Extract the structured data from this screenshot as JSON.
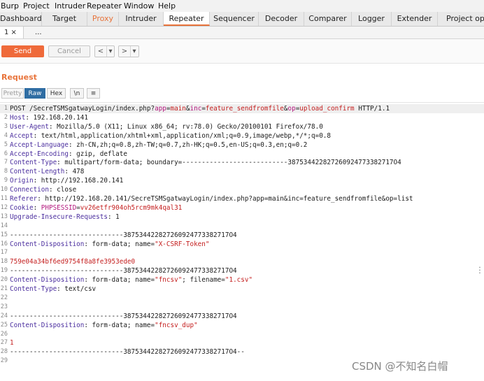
{
  "menu": [
    "Burp",
    "Project",
    "Intruder",
    "Repeater",
    "Window",
    "Help"
  ],
  "tabs": [
    "Dashboard",
    "Target",
    "Proxy",
    "Intruder",
    "Repeater",
    "Sequencer",
    "Decoder",
    "Comparer",
    "Logger",
    "Extender",
    "Project options"
  ],
  "subtabs": [
    "1 ×",
    "..."
  ],
  "toolbar": {
    "send": "Send",
    "cancel": "Cancel",
    "back": "<",
    "back_menu": "▾",
    "forward": ">",
    "forward_menu": "▾"
  },
  "request_title": "Request",
  "view_buttons": [
    "Pretty",
    "Raw",
    "Hex",
    "\\n",
    "≡"
  ],
  "request_lines": [
    [
      {
        "t": "POST /SecreTSMSgatwayLogin/index.php?",
        "c": "bd"
      },
      {
        "t": "app",
        "c": "ak"
      },
      {
        "t": "=",
        "c": "bd"
      },
      {
        "t": "main",
        "c": "cv"
      },
      {
        "t": "&",
        "c": "bd"
      },
      {
        "t": "inc",
        "c": "ak"
      },
      {
        "t": "=",
        "c": "bd"
      },
      {
        "t": "feature_sendfromfile",
        "c": "cv"
      },
      {
        "t": "&",
        "c": "bd"
      },
      {
        "t": "op",
        "c": "ak"
      },
      {
        "t": "=",
        "c": "bd"
      },
      {
        "t": "upload_confirm",
        "c": "cv"
      },
      {
        "t": " HTTP/1.1",
        "c": "bd"
      }
    ],
    [
      {
        "t": "Host",
        "c": "hk"
      },
      {
        "t": ": 192.168.20.141",
        "c": "bd"
      }
    ],
    [
      {
        "t": "User-Agent",
        "c": "hk"
      },
      {
        "t": ": Mozilla/5.0 (X11; Linux x86_64; rv:78.0) Gecko/20100101 Firefox/78.0",
        "c": "bd"
      }
    ],
    [
      {
        "t": "Accept",
        "c": "hk"
      },
      {
        "t": ": text/html,application/xhtml+xml,application/xml;q=0.9,image/webp,*/*;q=0.8",
        "c": "bd"
      }
    ],
    [
      {
        "t": "Accept-Language",
        "c": "hk"
      },
      {
        "t": ": zh-CN,zh;q=0.8,zh-TW;q=0.7,zh-HK;q=0.5,en-US;q=0.3,en;q=0.2",
        "c": "bd"
      }
    ],
    [
      {
        "t": "Accept-Encoding",
        "c": "hk"
      },
      {
        "t": ": gzip, deflate",
        "c": "bd"
      }
    ],
    [
      {
        "t": "Content-Type",
        "c": "hk"
      },
      {
        "t": ": multipart/form-data; boundary=---------------------------387534422827260924773382717O4",
        "c": "bd"
      }
    ],
    [
      {
        "t": "Content-Length",
        "c": "hk"
      },
      {
        "t": ": 478",
        "c": "bd"
      }
    ],
    [
      {
        "t": "Origin",
        "c": "hk"
      },
      {
        "t": ": http://192.168.20.141",
        "c": "bd"
      }
    ],
    [
      {
        "t": "Connection",
        "c": "hk"
      },
      {
        "t": ": close",
        "c": "bd"
      }
    ],
    [
      {
        "t": "Referer",
        "c": "hk"
      },
      {
        "t": ": http://192.168.20.141/SecreTSMSgatwayLogin/index.php?app=main&inc=feature_sendfromfile&op=list",
        "c": "bd"
      }
    ],
    [
      {
        "t": "Cookie",
        "c": "hk"
      },
      {
        "t": ": ",
        "c": "bd"
      },
      {
        "t": "PHPSESSID",
        "c": "ak"
      },
      {
        "t": "=",
        "c": "bd"
      },
      {
        "t": "vv26etfr904oh5rcm9mk4qal31",
        "c": "cv"
      }
    ],
    [
      {
        "t": "Upgrade-Insecure-Requests",
        "c": "hk"
      },
      {
        "t": ": 1",
        "c": "bd"
      }
    ],
    [],
    [
      {
        "t": "-----------------------------387534422827260924773382717O4",
        "c": "bd"
      }
    ],
    [
      {
        "t": "Content-Disposition",
        "c": "hk"
      },
      {
        "t": ": form-data; name=",
        "c": "bd"
      },
      {
        "t": "\"X-CSRF-Token\"",
        "c": "cv"
      }
    ],
    [],
    [
      {
        "t": "759e04a34bf6ed9754f8a8fe3953ede0",
        "c": "cv"
      }
    ],
    [
      {
        "t": "-----------------------------387534422827260924773382717O4",
        "c": "bd"
      }
    ],
    [
      {
        "t": "Content-Disposition",
        "c": "hk"
      },
      {
        "t": ": form-data; name=",
        "c": "bd"
      },
      {
        "t": "\"fncsv\"",
        "c": "cv"
      },
      {
        "t": "; filename=",
        "c": "bd"
      },
      {
        "t": "\"1.csv\"",
        "c": "cv"
      }
    ],
    [
      {
        "t": "Content-Type",
        "c": "hk"
      },
      {
        "t": ": text/csv",
        "c": "bd"
      }
    ],
    [],
    [],
    [
      {
        "t": "-----------------------------387534422827260924773382717O4",
        "c": "bd"
      }
    ],
    [
      {
        "t": "Content-Disposition",
        "c": "hk"
      },
      {
        "t": ": form-data; name=",
        "c": "bd"
      },
      {
        "t": "\"fncsv_dup\"",
        "c": "cv"
      }
    ],
    [],
    [
      {
        "t": "1",
        "c": "cv"
      }
    ],
    [
      {
        "t": "-----------------------------387534422827260924773382717O4--",
        "c": "bd"
      }
    ],
    []
  ],
  "watermark": "CSDN @不知名白帽",
  "colors": {
    "accent": "#e8733a",
    "send_bg": "#ef6a3a",
    "raw_selected": "#2f6da3",
    "header_key": "#4a2d9e",
    "param_key": "#b2167c",
    "value": "#c41e1e"
  }
}
